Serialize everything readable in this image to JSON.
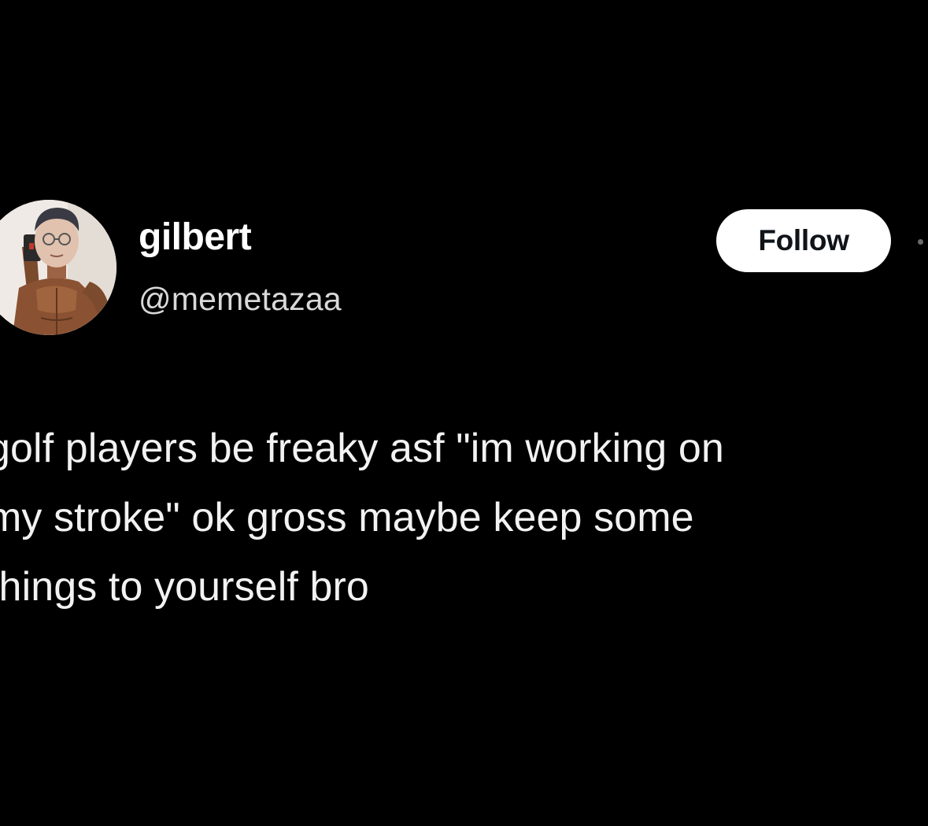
{
  "author": {
    "display_name": "gilbert",
    "handle": "@memetazaa",
    "avatar_icon": "profile-photo"
  },
  "actions": {
    "follow_label": "Follow",
    "more_icon": "more-dots-icon"
  },
  "tweet": {
    "lines": [
      "golf players be freaky asf \"im working on",
      "my stroke\" ok gross maybe keep some",
      "things to yourself bro"
    ]
  },
  "colors": {
    "background": "#000000",
    "text": "#f2f2f2",
    "button_bg": "#ffffff",
    "button_text": "#0f1419"
  }
}
